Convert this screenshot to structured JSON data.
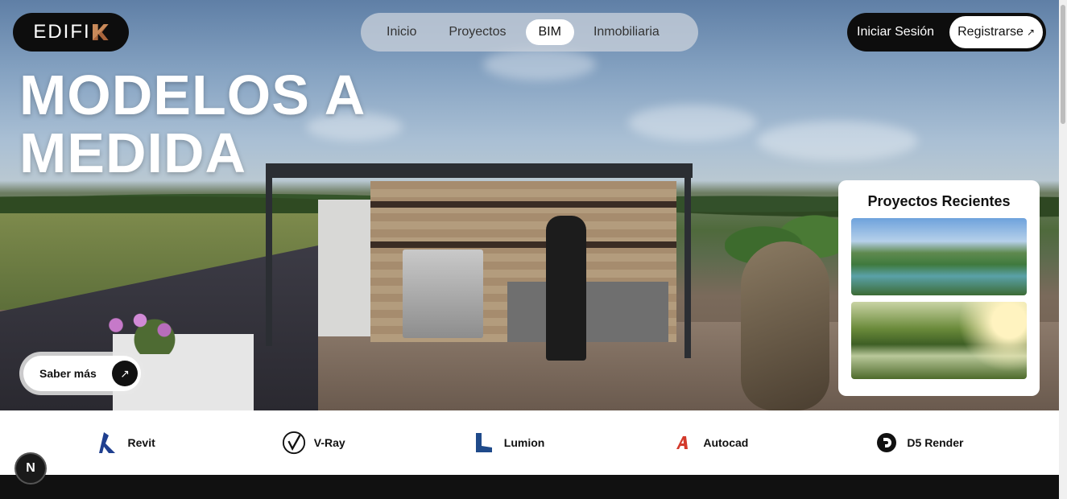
{
  "brand": {
    "logo_text": "EDIFI",
    "logo_mark": "K-mark",
    "accent": "#b8734a"
  },
  "nav": {
    "items": [
      {
        "label": "Inicio",
        "active": false
      },
      {
        "label": "Proyectos",
        "active": false
      },
      {
        "label": "BIM",
        "active": true
      },
      {
        "label": "Inmobiliaria",
        "active": false
      }
    ]
  },
  "auth": {
    "login_label": "Iniciar Sesión",
    "register_label": "Registrarse",
    "register_icon": "arrow-up-right-icon"
  },
  "hero": {
    "headline_line1": "MODELOS A",
    "headline_line2": "MEDIDA",
    "cta_label": "Saber más",
    "cta_icon": "arrow-up-right-icon"
  },
  "recent_projects": {
    "title": "Proyectos Recientes",
    "thumbnails": [
      "lake-park-render",
      "sunset-park-render"
    ]
  },
  "tools": [
    {
      "name": "Revit",
      "icon": "revit-icon",
      "color": "#1f3f8f"
    },
    {
      "name": "V-Ray",
      "icon": "vray-icon",
      "color": "#111111"
    },
    {
      "name": "Lumion",
      "icon": "lumion-icon",
      "color": "#1f4a8a"
    },
    {
      "name": "Autocad",
      "icon": "autocad-icon",
      "color": "#d33a2c"
    },
    {
      "name": "D5 Render",
      "icon": "d5-render-icon",
      "color": "#111111"
    }
  ],
  "dev_badge": {
    "label": "N"
  }
}
